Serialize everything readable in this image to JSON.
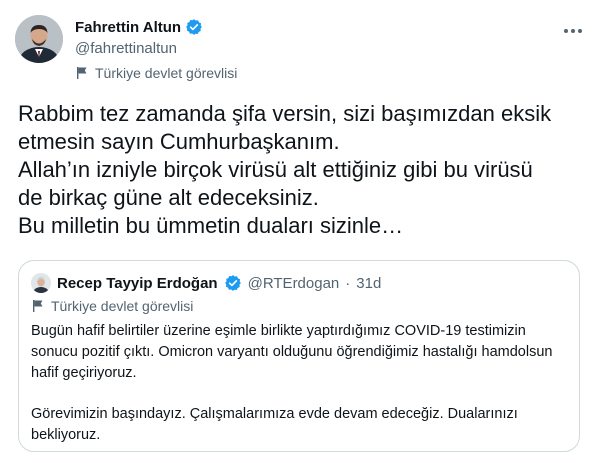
{
  "author": {
    "name": "Fahrettin Altun",
    "handle": "@fahrettinaltun",
    "label": "Türkiye devlet görevlisi"
  },
  "tweet": {
    "lines": [
      "Rabbim tez zamanda şifa versin, sizi başımızdan eksik",
      "etmesin sayın Cumhurbaşkanım.",
      "Allah’ın izniyle birçok virüsü alt ettiğiniz gibi bu virüsü",
      "de birkaç güne alt edeceksiniz.",
      "Bu milletin bu ümmetin duaları sizinle…"
    ]
  },
  "quoted": {
    "name": "Recep Tayyip Erdoğan",
    "handle": "@RTErdogan",
    "separator": "·",
    "time": "31d",
    "label": "Türkiye devlet görevlisi",
    "paragraph1": [
      "Bugün hafif belirtiler üzerine eşimle birlikte yaptırdığımız COVID-19 testimizin",
      "sonucu pozitif çıktı. Omicron varyantı olduğunu öğrendiğimiz hastalığı hamdolsun",
      "hafif geçiriyoruz."
    ],
    "paragraph2": [
      "Görevimizin başındayız. Çalışmalarımıza evde devam edeceğiz. Dualarınızı",
      "bekliyoruz."
    ]
  },
  "colors": {
    "text": "#0f1419",
    "secondary": "#536471",
    "verified": "#1d9bf0",
    "border": "#cfd9de"
  },
  "icons": {
    "verified": "verified-badge-icon",
    "flag": "flag-icon",
    "more": "more-horizontal-icon"
  }
}
